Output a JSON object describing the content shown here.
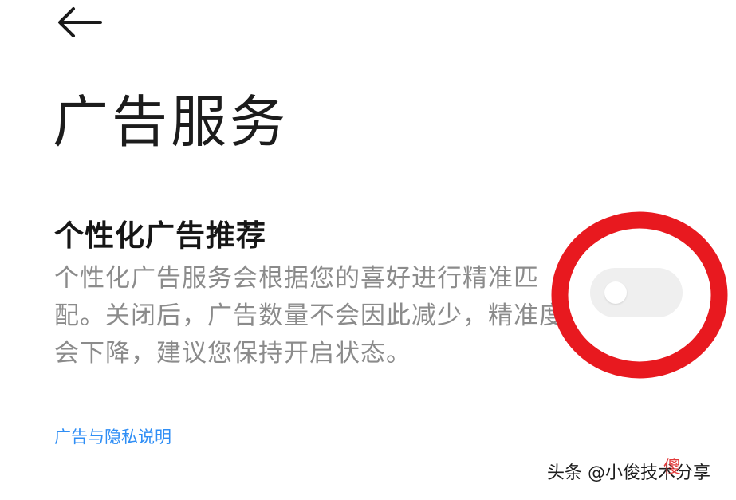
{
  "header": {
    "back_icon": "arrow-left-icon",
    "title": "广告服务"
  },
  "setting": {
    "title": "个性化广告推荐",
    "description": "个性化广告服务会根据您的喜好进行精准匹配。关闭后，广告数量不会因此减少，精准度会下降，建议您保持开启状态。",
    "toggle_state": "off"
  },
  "links": {
    "privacy": "广告与隐私说明"
  },
  "watermark": {
    "text": "头条 @小俊技术分享",
    "overlay_text": "傻"
  },
  "colors": {
    "link": "#2f8ef5",
    "highlight_circle": "#e8191f",
    "toggle_track": "#efefef"
  }
}
